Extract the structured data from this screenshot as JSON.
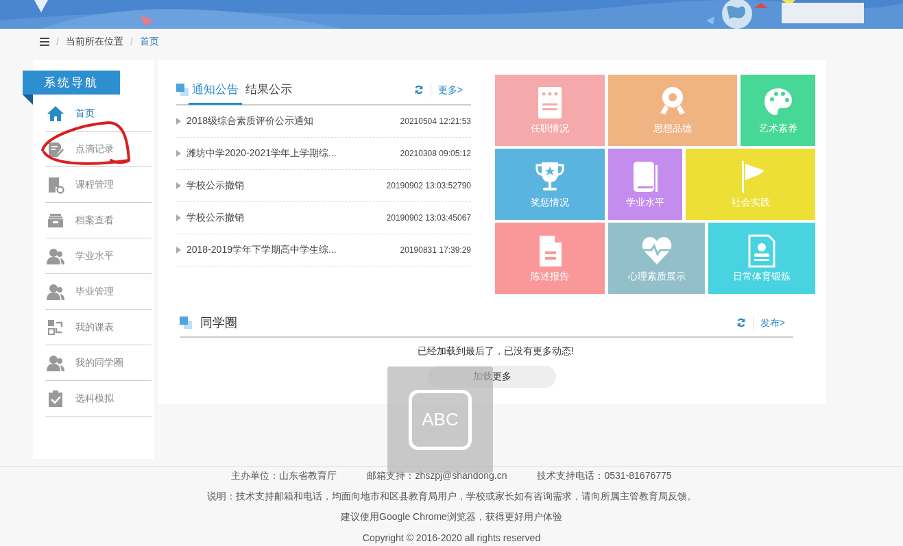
{
  "breadcrumb": {
    "separator": "/",
    "items": [
      {
        "label": "当前所在位置",
        "selected": false
      },
      {
        "label": "首页",
        "selected": true
      }
    ]
  },
  "sidebar": {
    "title": "系统导航",
    "items": [
      {
        "label": "首页",
        "selected": true
      },
      {
        "label": "点滴记录",
        "selected": false
      },
      {
        "label": "课程管理",
        "selected": false
      },
      {
        "label": "档案查看",
        "selected": false
      },
      {
        "label": "学业水平",
        "selected": false
      },
      {
        "label": "毕业管理",
        "selected": false
      },
      {
        "label": "我的课表",
        "selected": false
      },
      {
        "label": "我的同学圈",
        "selected": false
      },
      {
        "label": "选科模拟",
        "selected": false
      }
    ]
  },
  "notices": {
    "tabs": [
      {
        "label": "通知公告",
        "selected": true
      },
      {
        "label": "结果公示",
        "selected": false
      }
    ],
    "more": "更多>",
    "rows": [
      {
        "title": "2018级综合素质评价公示通知",
        "time": "20210504 12:21:53"
      },
      {
        "title": "潍坊中学2020-2021学年上学期综...",
        "time": "20210308 09:05:12"
      },
      {
        "title": "学校公示撤销",
        "time": "20190902 13:03:52790"
      },
      {
        "title": "学校公示撤销",
        "time": "20190902 13:03:45067"
      },
      {
        "title": "2018-2019学年下学期高中学生综...",
        "time": "20190831 17:39:29"
      }
    ]
  },
  "tiles": [
    [
      {
        "label": "任职情况",
        "color": "#f5a9aa"
      },
      {
        "label": "思想品德",
        "color": "#f0b483"
      },
      {
        "label": "艺术素养",
        "color": "#47d796"
      }
    ],
    [
      {
        "label": "奖惩情况",
        "color": "#5bb4e0"
      },
      {
        "label": "学业水平",
        "color": "#c48cec"
      },
      {
        "label": "社会实践",
        "color": "#eddf36"
      }
    ],
    [
      {
        "label": "陈述报告",
        "color": "#fa9899"
      },
      {
        "label": "心理素质展示",
        "color": "#93bfcb"
      },
      {
        "label": "日常体育锻炼",
        "color": "#47d3e0"
      }
    ]
  ],
  "classmates": {
    "title": "同学圈",
    "publish": "发布>",
    "message": "已经加载到最后了，已没有更多动态!",
    "load_more": "加载更多"
  },
  "ime_indicator": {
    "label": "ABC"
  },
  "footer": {
    "lines": [
      [
        "主办单位：山东省教育厅",
        "邮箱支持：zhszpj@shandong.cn",
        "技术支持电话：0531-81676775"
      ],
      [
        "说明：技术支持邮箱和电话，均面向地市和区县教育局用户，学校或家长如有咨询需求，请向所属主管教育局反馈。"
      ],
      [
        "建议使用Google Chrome浏览器，获得更好用户体验"
      ],
      [
        "Copyright © 2016-2020 all rights reserved"
      ]
    ]
  }
}
